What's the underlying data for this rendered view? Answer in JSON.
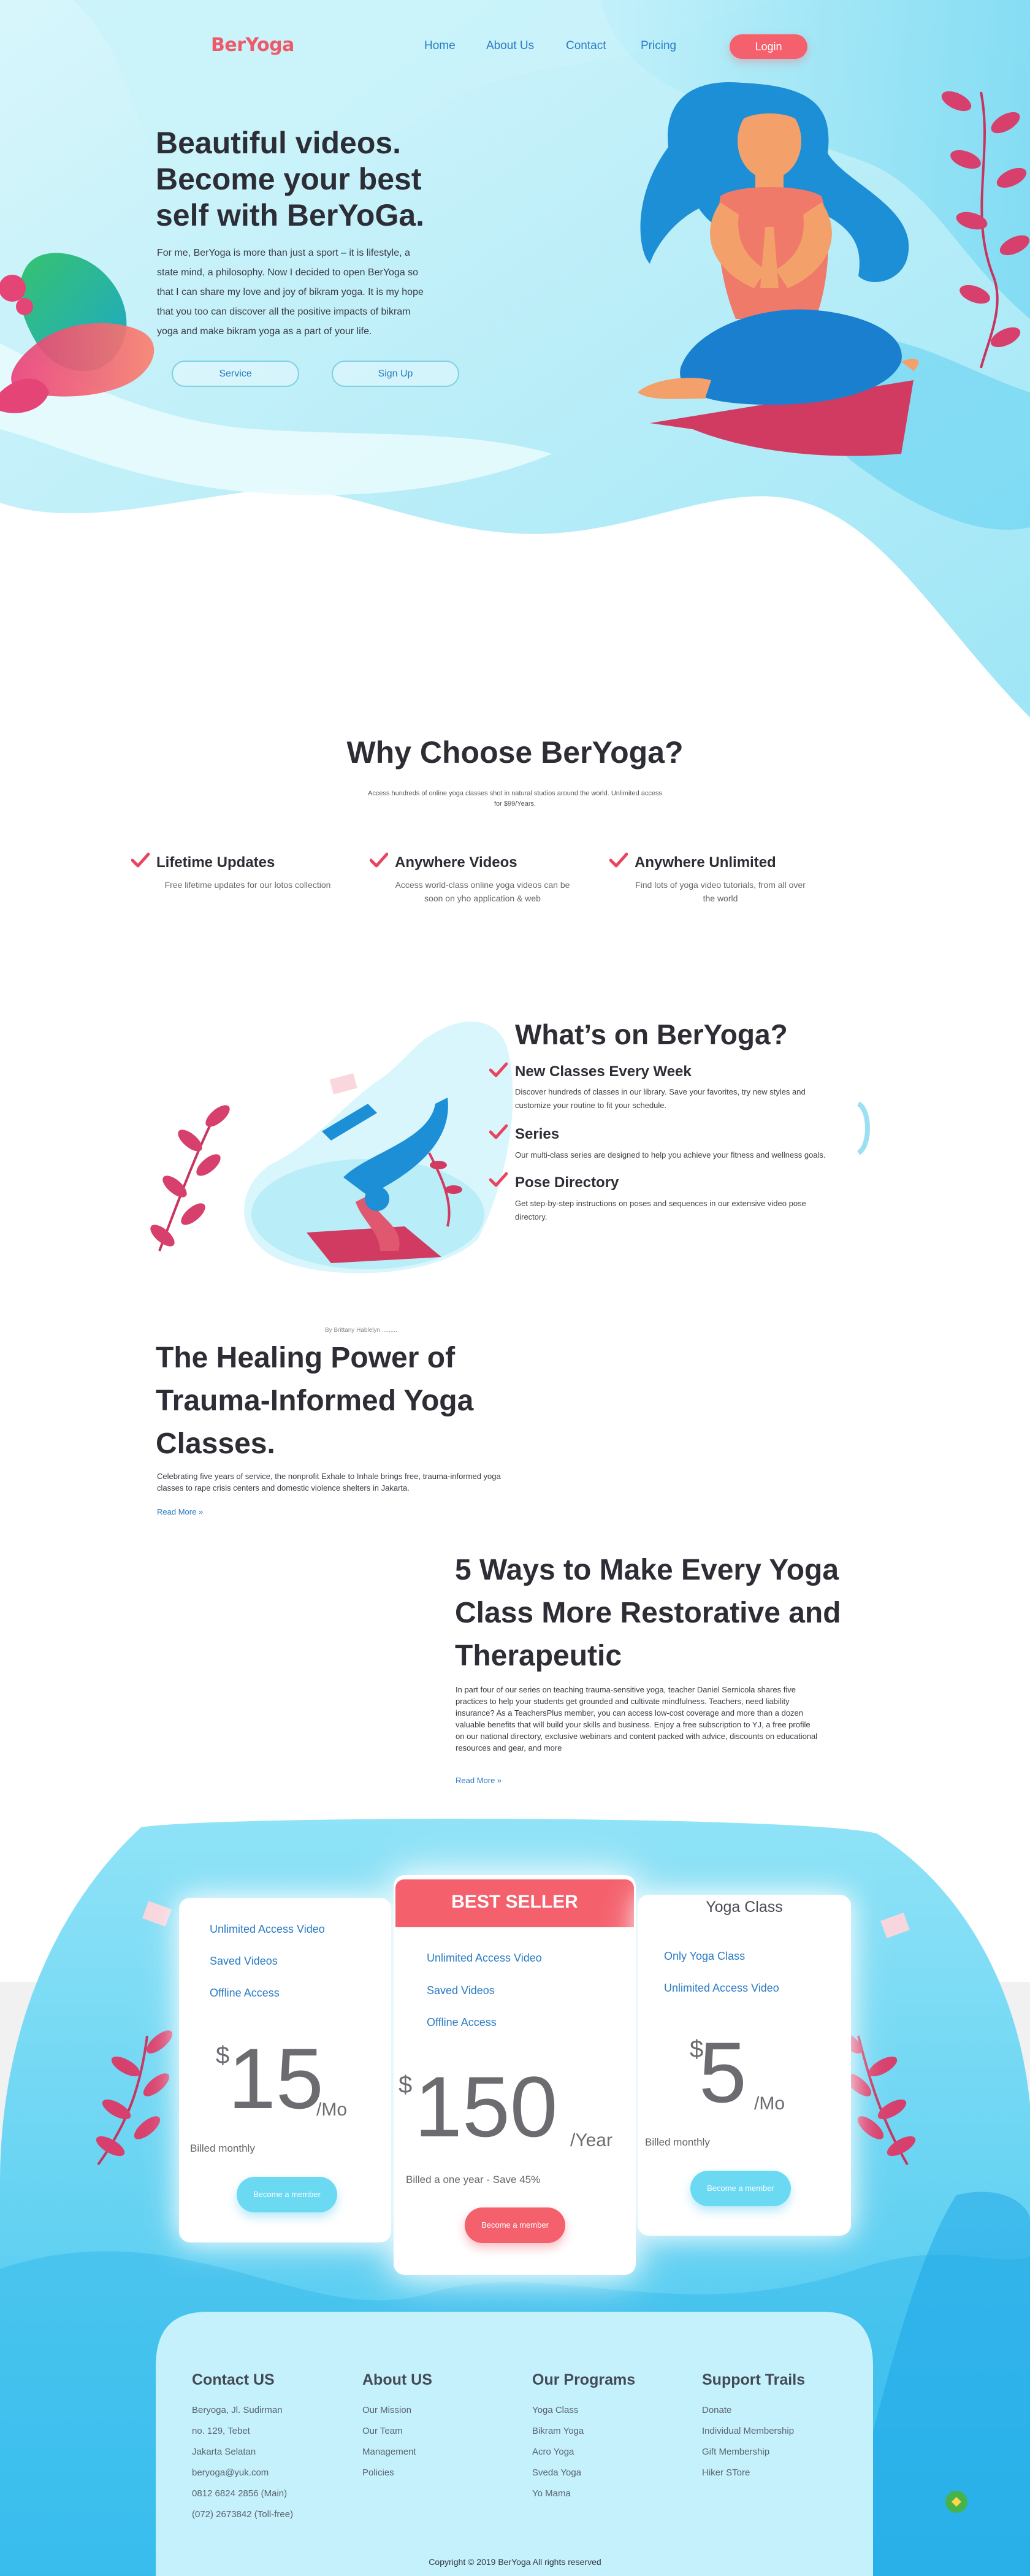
{
  "brand": {
    "name": "BerYoga"
  },
  "nav": {
    "links": [
      "Home",
      "About Us",
      "Contact",
      "Pricing"
    ],
    "login": "Login"
  },
  "hero": {
    "title_lines": [
      "Beautiful videos.",
      "Become your best",
      "self with BerYoGa."
    ],
    "text_lines": [
      "For me, BerYoga is more than just a sport – it is lifestyle, a",
      "state mind, a philosophy. Now I decided to open BerYoga so",
      "that I can share my love and joy of bikram yoga. It is my hope",
      "that you too can discover all the positive impacts of bikram",
      "yoga and make bikram yoga as a part of your life."
    ],
    "buttons": {
      "service": "Service",
      "signup": "Sign Up"
    }
  },
  "why": {
    "title": "Why Choose BerYoga?",
    "subtitle_lines": [
      "Access hundreds of online yoga classes shot in natural studios around the world. Unlimited access",
      "for $99/Years."
    ],
    "features": [
      {
        "title": "Lifetime Updates",
        "text_lines": [
          "Free lifetime updates for our lotos collection"
        ]
      },
      {
        "title": "Anywhere Videos",
        "text_lines": [
          "Access world-class online yoga videos can be",
          "soon on yho application & web"
        ]
      },
      {
        "title": "Anywhere Unlimited",
        "text_lines": [
          "Find lots of yoga video tutorials, from all over",
          "the world"
        ]
      }
    ]
  },
  "whats_on": {
    "title": "What’s on BerYoga?",
    "items": [
      {
        "title": "New Classes Every Week",
        "text_lines": [
          "Discover hundreds of classes in our library. Save your favorites, try new styles and",
          "customize your routine to fit your schedule."
        ]
      },
      {
        "title": "Series",
        "text_lines": [
          "Our multi-class series are designed to help you achieve your fitness and wellness goals."
        ]
      },
      {
        "title": "Pose Directory",
        "text_lines": [
          "Get step-by-step instructions on poses and sequences in our extensive video pose",
          "directory."
        ]
      }
    ]
  },
  "articles": [
    {
      "byline": "By Brittany Hablelyn .........",
      "title_lines": [
        "The Healing Power of",
        "Trauma-Informed Yoga",
        "Classes."
      ],
      "text_lines": [
        "Celebrating five years of service, the nonprofit Exhale to Inhale brings free, trauma-informed yoga",
        "classes to rape crisis centers and domestic violence shelters in Jakarta."
      ],
      "read_more": "Read More »"
    },
    {
      "title_lines": [
        "5 Ways to Make Every Yoga",
        "Class More Restorative and",
        "Therapeutic"
      ],
      "text_lines": [
        "In part four of our series on teaching trauma-sensitive yoga, teacher Daniel Sernicola shares five",
        "practices to help your students get grounded and cultivate mindfulness. Teachers, need liability",
        "insurance? As a TeachersPlus member, you can access low-cost coverage and more than a dozen",
        "valuable benefits that will build your skills and business. Enjoy a free subscription to YJ, a free profile",
        "on our national directory, exclusive webinars and content packed with advice, discounts on educational",
        "resources and gear, and more"
      ],
      "read_more": "Read More »"
    }
  ],
  "pricing": {
    "plans": [
      {
        "features": [
          "Unlimited Access Video",
          "Saved Videos",
          "Offline Access"
        ],
        "currency": "$",
        "amount": "15",
        "period": "/Mo",
        "billing": "Billed monthly",
        "button": "Become a member"
      },
      {
        "badge": "BEST SELLER",
        "features": [
          "Unlimited Access Video",
          "Saved Videos",
          "Offline Access"
        ],
        "currency": "$",
        "amount": "150",
        "period": "/Year",
        "billing": "Billed a one year - Save 45%",
        "button": "Become a member"
      },
      {
        "title": "Yoga Class",
        "features": [
          "Only Yoga Class",
          "Unlimited Access Video"
        ],
        "currency": "$",
        "amount": "5",
        "period": "/Mo",
        "billing": "Billed monthly",
        "button": "Become a member"
      }
    ]
  },
  "footer": {
    "columns": [
      {
        "title": "Contact US",
        "items": [
          "Beryoga, Jl. Sudirman",
          "no. 129, Tebet",
          "Jakarta Selatan",
          "beryoga@yuk.com",
          "0812 6824 2856 (Main)",
          "(072) 2673842 (Toll-free)"
        ]
      },
      {
        "title": "About US",
        "items": [
          "Our Mission",
          "Our Team",
          "Management",
          "Policies"
        ]
      },
      {
        "title": "Our Programs",
        "items": [
          "Yoga Class",
          "Bikram Yoga",
          "Acro Yoga",
          "Sveda Yoga",
          "Yo Mama"
        ]
      },
      {
        "title": "Support Trails",
        "items": [
          "Donate",
          "Individual Membership",
          "Gift Membership",
          "Hiker STore"
        ]
      }
    ],
    "copyright": "Copyright © 2019 BerYoga All rights reserved"
  },
  "colors": {
    "brand": "#ef5a6a",
    "link": "#2a7bc4",
    "cyan": "#62d2f2",
    "coral": "#f4606c"
  }
}
